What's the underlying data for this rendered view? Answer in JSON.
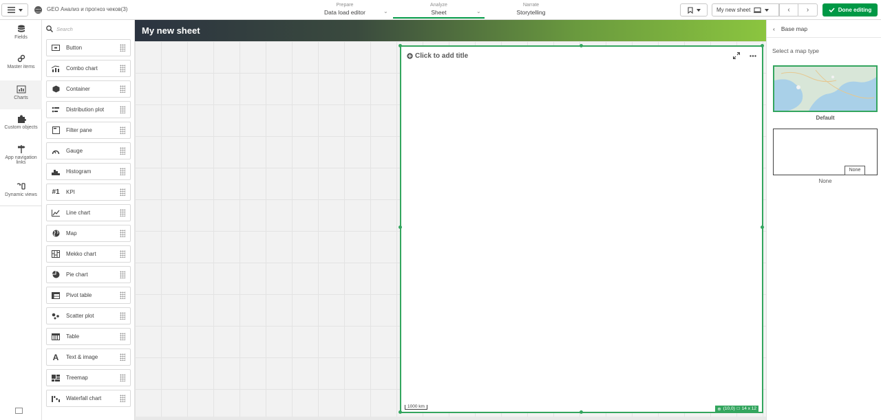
{
  "topbar": {
    "app_title": "GEO Анализ и прогноз чеков(3)",
    "tabs": [
      {
        "sup": "Prepare",
        "label": "Data load editor"
      },
      {
        "sup": "Analyze",
        "label": "Sheet"
      },
      {
        "sup": "Narrate",
        "label": "Storytelling"
      }
    ],
    "sheet_selector": "My new sheet",
    "done_label": "Done editing"
  },
  "rail": {
    "items": [
      {
        "label": "Fields",
        "icon": "database-icon"
      },
      {
        "label": "Master items",
        "icon": "link-icon"
      },
      {
        "label": "Charts",
        "icon": "bar-chart-icon"
      },
      {
        "label": "Custom objects",
        "icon": "puzzle-icon"
      },
      {
        "label": "App navigation links",
        "icon": "signpost-icon"
      },
      {
        "label": "Dynamic views",
        "icon": "dynamic-view-icon"
      }
    ]
  },
  "panel": {
    "search_placeholder": "Search",
    "charts": [
      "Button",
      "Combo chart",
      "Container",
      "Distribution plot",
      "Filter pane",
      "Gauge",
      "Histogram",
      "KPI",
      "Line chart",
      "Map",
      "Mekko chart",
      "Pie chart",
      "Pivot table",
      "Scatter plot",
      "Table",
      "Text & image",
      "Treemap",
      "Waterfall chart"
    ]
  },
  "sheet": {
    "title": "My new sheet",
    "map": {
      "add_title": "Click to add title",
      "scale": "1000 km",
      "position": "(10,0)",
      "size": "14 x 12"
    }
  },
  "props": {
    "header": "Base map",
    "subtitle": "Select a map type",
    "options": [
      {
        "label": "Default",
        "selected": true
      },
      {
        "label": "None",
        "selected": false
      }
    ],
    "tooltip": "None"
  },
  "colors": {
    "accent": "#009845",
    "selection": "#33a55e",
    "header_dark": "#2b3340",
    "header_light": "#8bc53f"
  }
}
